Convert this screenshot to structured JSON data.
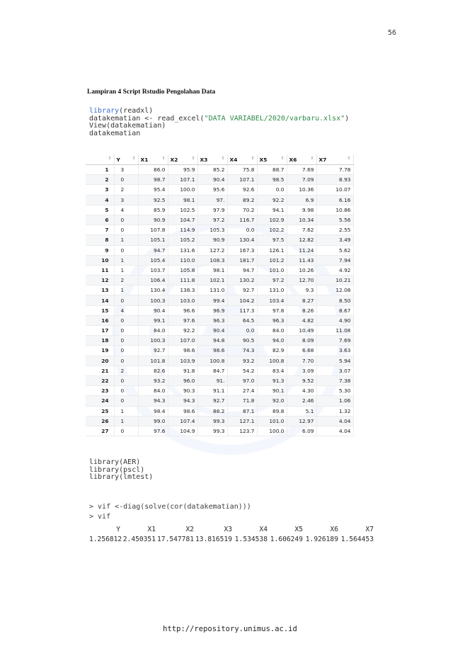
{
  "page_number": "56",
  "section_heading": "Lampiran 4 Script Rstudio Pengolahan Data",
  "code_block_1": {
    "lines": [
      {
        "pre": "",
        "fn": "library",
        "rest": "(readxl)"
      },
      {
        "pre": "datakematian <- read_excel(",
        "str": "\"DATA VARIABEL/2020/varbaru.xlsx\"",
        "rest": ")"
      },
      {
        "pre": "View(datakematian)",
        "str": "",
        "rest": ""
      },
      {
        "pre": "datakematian",
        "str": "",
        "rest": ""
      }
    ]
  },
  "table": {
    "headers": [
      "",
      "Y",
      "X1",
      "X2",
      "X3",
      "X4",
      "X5",
      "X6",
      "X7"
    ],
    "rows": [
      [
        "1",
        "3",
        "86.0",
        "95.9",
        "85.2",
        "75.8",
        "88.7",
        "7.69",
        "7.78"
      ],
      [
        "2",
        "0",
        "98.7",
        "107.1",
        "90.4",
        "107.1",
        "98.5",
        "7.09",
        "8.93"
      ],
      [
        "3",
        "2",
        "95.4",
        "100.0",
        "95.6",
        "92.6",
        "0.0",
        "10.36",
        "10.07"
      ],
      [
        "4",
        "3",
        "92.5",
        "98.1",
        "97.",
        "89.2",
        "92.2",
        "6.9",
        "6.16"
      ],
      [
        "5",
        "4",
        "85.9",
        "102.5",
        "97.9",
        "70.2",
        "94.1",
        "9.98",
        "10.86"
      ],
      [
        "6",
        "0",
        "90.9",
        "104.7",
        "97.2",
        "116.7",
        "102.9",
        "10.34",
        "5.56"
      ],
      [
        "7",
        "0",
        "107.8",
        "114.9",
        "105.3",
        "0.0",
        "102.2",
        "7.62",
        "2.55"
      ],
      [
        "8",
        "1",
        "105.1",
        "105.2",
        "90.9",
        "130.4",
        "97.5",
        "12.82",
        "3.49"
      ],
      [
        "9",
        "0",
        "94.7",
        "131.6",
        "127.2",
        "167.3",
        "126.1",
        "11.24",
        "5.62"
      ],
      [
        "10",
        "1",
        "105.4",
        "110.0",
        "108.3",
        "181.7",
        "101.2",
        "11.43",
        "7.94"
      ],
      [
        "11",
        "1",
        "103.7",
        "105.8",
        "98.1",
        "94.7",
        "101.0",
        "10.26",
        "4.92"
      ],
      [
        "12",
        "2",
        "106.4",
        "111.8",
        "102.1",
        "130.2",
        "97.2",
        "12.70",
        "10.21"
      ],
      [
        "13",
        "1",
        "130.4",
        "138.3",
        "131.0",
        "92.7",
        "131.0",
        "9.3",
        "12.08"
      ],
      [
        "14",
        "0",
        "100.3",
        "103.0",
        "99.4",
        "104.2",
        "103.4",
        "8.27",
        "8.50"
      ],
      [
        "15",
        "4",
        "90.4",
        "96.6",
        "96.9",
        "117.3",
        "97.8",
        "8.26",
        "8.67"
      ],
      [
        "16",
        "0",
        "99.1",
        "97.6",
        "96.3",
        "64.5",
        "96.3",
        "4.82",
        "4.90"
      ],
      [
        "17",
        "0",
        "84.0",
        "92.2",
        "90.4",
        "0.0",
        "84.0",
        "10.49",
        "11.08"
      ],
      [
        "18",
        "0",
        "100.3",
        "107.0",
        "94.8",
        "90.5",
        "94.0",
        "8.09",
        "7.69"
      ],
      [
        "19",
        "0",
        "92.7",
        "98.6",
        "98.6",
        "74.3",
        "82.9",
        "6.68",
        "3.63"
      ],
      [
        "20",
        "0",
        "101.8",
        "103.9",
        "100.8",
        "93.2",
        "100.8",
        "7.70",
        "5.94"
      ],
      [
        "21",
        "2",
        "82.6",
        "91.8",
        "84.7",
        "54.2",
        "83.4",
        "3.09",
        "3.07"
      ],
      [
        "22",
        "0",
        "93.2",
        "96.0",
        "91.",
        "97.0",
        "91.3",
        "9.52",
        "7.38"
      ],
      [
        "23",
        "0",
        "84.0",
        "90.3",
        "91.1",
        "27.4",
        "90.1",
        "4.30",
        "5.30"
      ],
      [
        "24",
        "0",
        "94.3",
        "94.3",
        "92.7",
        "71.8",
        "92.0",
        "2.46",
        "1.06"
      ],
      [
        "25",
        "1",
        "98.4",
        "98.6",
        "88.2",
        "87.1",
        "89.8",
        "5.1",
        "1.32"
      ],
      [
        "26",
        "1",
        "99.0",
        "107.4",
        "99.3",
        "127.1",
        "101.0",
        "12.97",
        "4.04"
      ],
      [
        "27",
        "0",
        "97.6",
        "104.9",
        "99.3",
        "123.7",
        "100.0",
        "6.09",
        "4.04"
      ]
    ]
  },
  "code_block_2": {
    "lines": [
      "library(AER)",
      "library(pscl)",
      "library(lmtest)"
    ]
  },
  "console": {
    "lines": [
      "> vif <-diag(solve(cor(datakematian)))",
      "> vif"
    ]
  },
  "vif": {
    "names": [
      "Y",
      "X1",
      "X2",
      "X3",
      "X4",
      "X5",
      "X6",
      "X7"
    ],
    "values": [
      "1.256812",
      "2.450351",
      "17.547781",
      "13.816519",
      "1.534538",
      "1.606249",
      "1.926189",
      "1.564453"
    ]
  },
  "footer_url": "http://repository.unimus.ac.id"
}
